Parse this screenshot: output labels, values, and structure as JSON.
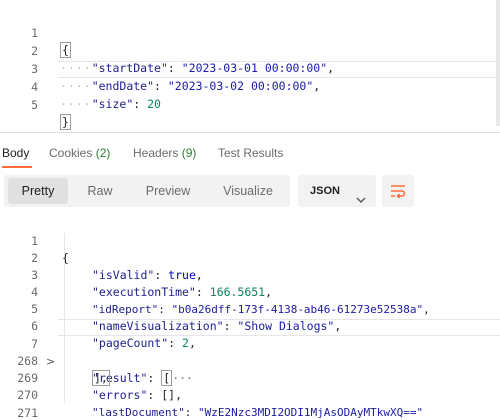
{
  "request_body": {
    "lines": [
      {
        "num": "1",
        "open": "{"
      },
      {
        "num": "2",
        "indent": "····",
        "key": "\"startDate\"",
        "sep": ": ",
        "value": "\"2023-03-01 00:00:00\"",
        "trail": ","
      },
      {
        "num": "3",
        "indent": "····",
        "key": "\"endDate\"",
        "sep": ": ",
        "value": "\"2023-03-02 00:00:00\"",
        "trail": ","
      },
      {
        "num": "4",
        "indent": "····",
        "key": "\"size\"",
        "sep": ": ",
        "value": "20",
        "trail": ""
      },
      {
        "num": "5",
        "close": "}"
      }
    ]
  },
  "response_tabs": {
    "body": "Body",
    "cookies": "Cookies",
    "cookies_count": "(2)",
    "headers": "Headers",
    "headers_count": "(9)",
    "test_results": "Test Results"
  },
  "view_toolbar": {
    "pretty": "Pretty",
    "raw": "Raw",
    "preview": "Preview",
    "visualize": "Visualize",
    "format": "JSON",
    "format_icon": "chevron-down-icon",
    "wrap_icon": "wrap-lines-icon"
  },
  "response_body": {
    "lines": [
      {
        "num": "1",
        "text": "{"
      },
      {
        "num": "2",
        "key": "\"isValid\"",
        "sep": ": ",
        "value": "true",
        "trail": ","
      },
      {
        "num": "3",
        "key": "\"executionTime\"",
        "sep": ": ",
        "value": "166.5651",
        "trail": ","
      },
      {
        "num": "4",
        "key": "\"idReport\"",
        "sep": ": ",
        "value": "\"b0a26dff-173f-4138-ab46-61273e52538a\"",
        "trail": ","
      },
      {
        "num": "5",
        "key": "\"nameVisualization\"",
        "sep": ": ",
        "value": "\"Show Dialogs\"",
        "trail": ","
      },
      {
        "num": "6",
        "key": "\"pageCount\"",
        "sep": ": ",
        "value": "2",
        "trail": ","
      },
      {
        "num": "7",
        "key": "\"result\"",
        "sep": ": ",
        "value": "[",
        "ellipsis": "···",
        "fold": ">"
      },
      {
        "num": "268",
        "text": "],"
      },
      {
        "num": "269",
        "key": "\"errors\"",
        "sep": ": ",
        "value": "[]",
        "trail": ","
      },
      {
        "num": "270",
        "key": "\"lastDocument\"",
        "sep": ": ",
        "value": "\"WzE2Nzc3MDI2ODI1MjAsODAyMTkwXQ==\"",
        "trail": ""
      },
      {
        "num": "271",
        "text": "}"
      }
    ]
  },
  "colors": {
    "accent": "#ff6c37",
    "count_green": "#2e7d32",
    "json_key": "#1e1e8c",
    "json_string": "#1a1aa6",
    "json_number": "#098658"
  }
}
